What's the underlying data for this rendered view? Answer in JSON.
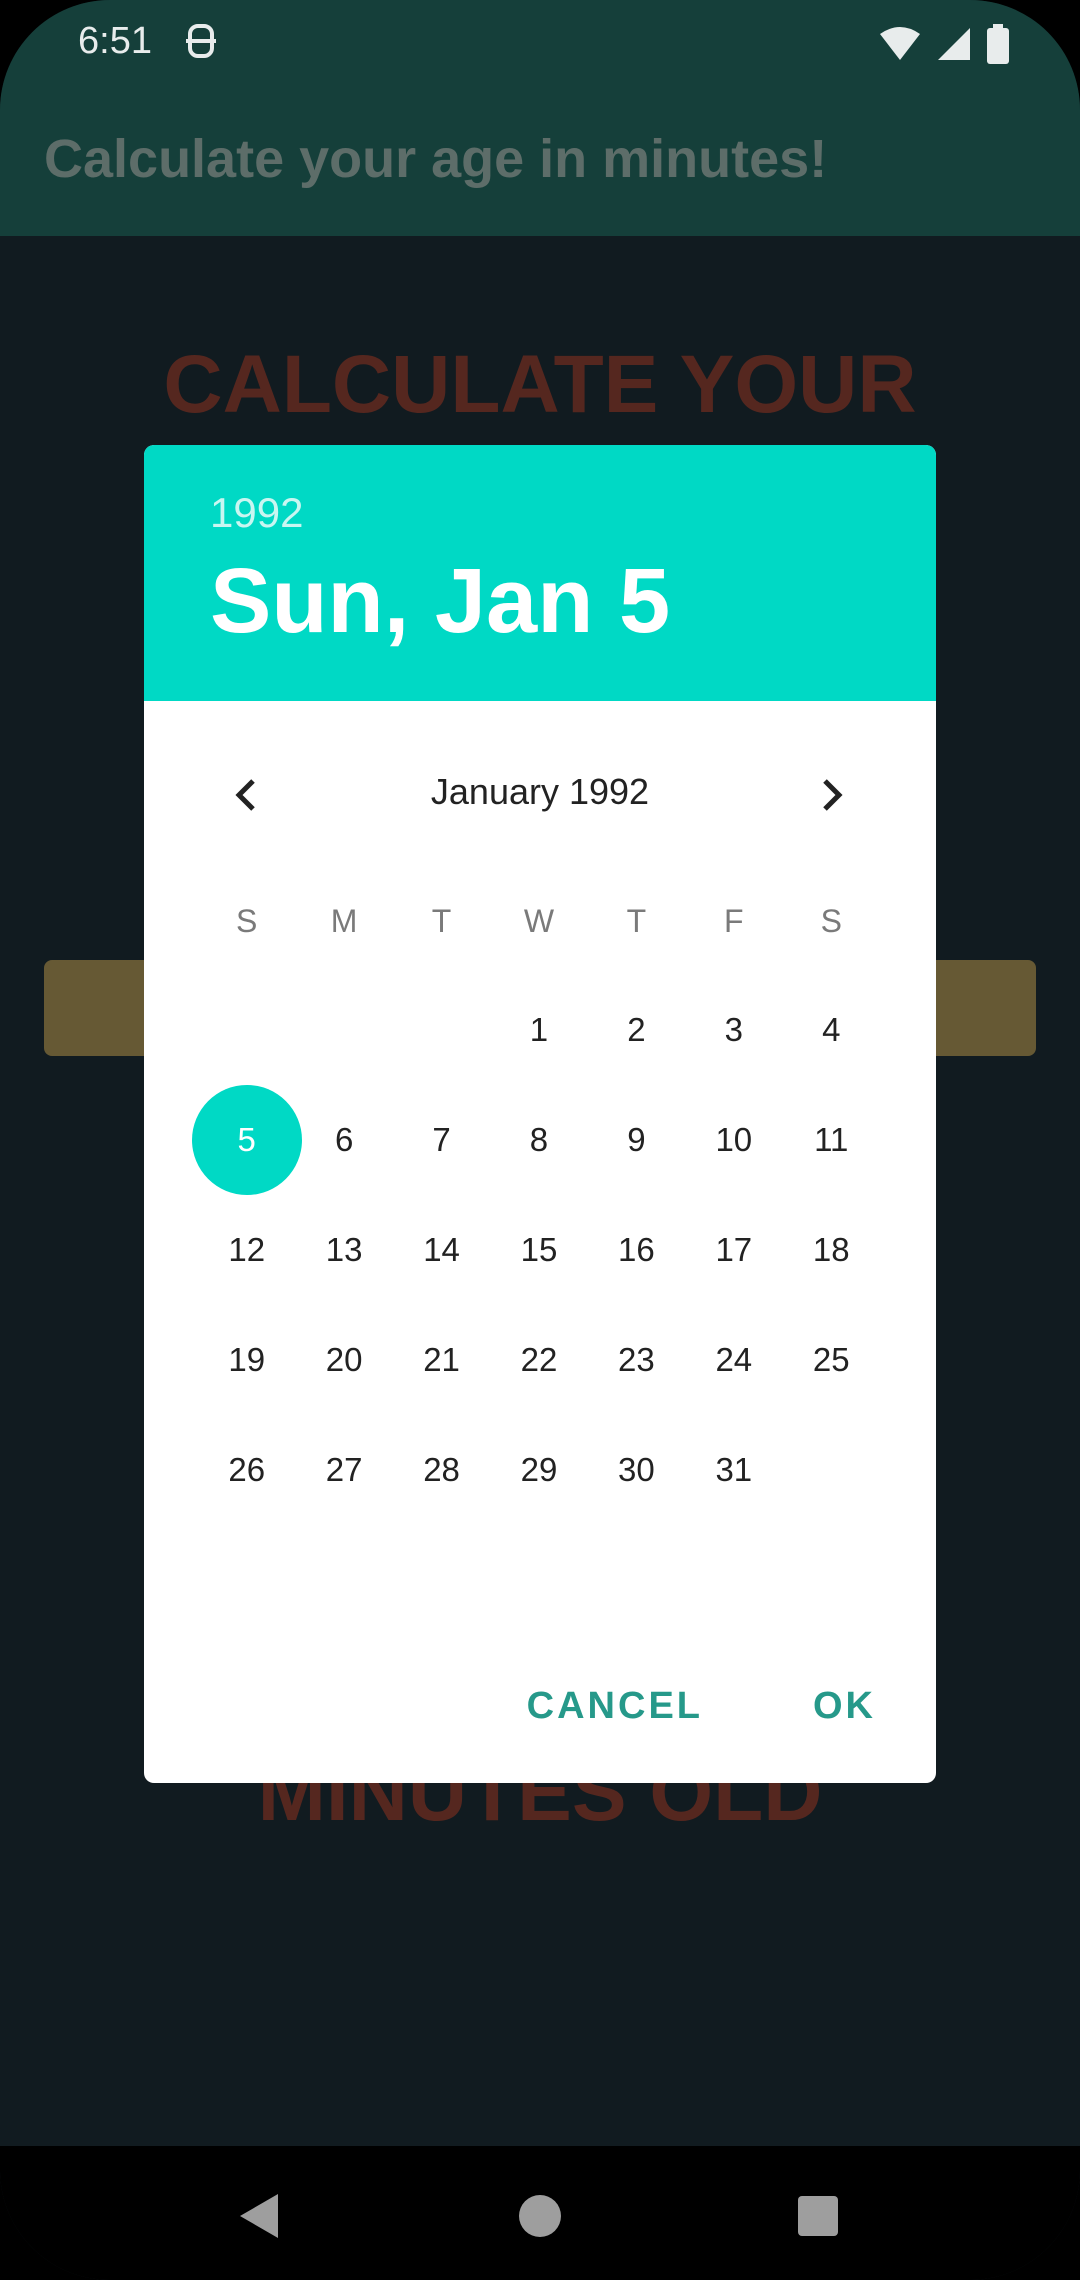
{
  "status": {
    "time": "6:51"
  },
  "app": {
    "title": "Calculate your age in minutes!",
    "bg_heading_top": "CALCULATE YOUR",
    "bg_heading_bottom": "MINUTES OLD"
  },
  "dialog": {
    "year": "1992",
    "selected_date": "Sun, Jan 5",
    "month_title": "January 1992",
    "weekdays": [
      "S",
      "M",
      "T",
      "W",
      "T",
      "F",
      "S"
    ],
    "days": [
      "",
      "",
      "",
      "1",
      "2",
      "3",
      "4",
      "5",
      "6",
      "7",
      "8",
      "9",
      "10",
      "11",
      "12",
      "13",
      "14",
      "15",
      "16",
      "17",
      "18",
      "19",
      "20",
      "21",
      "22",
      "23",
      "24",
      "25",
      "26",
      "27",
      "28",
      "29",
      "30",
      "31",
      ""
    ],
    "selected_day": "5",
    "cancel_label": "CANCEL",
    "ok_label": "OK"
  },
  "colors": {
    "accent": "#00d9c5",
    "action_text": "#26998a",
    "app_bar": "#153f3a"
  },
  "icons": {
    "prev": "chevron-left-icon",
    "next": "chevron-right-icon",
    "back": "back-triangle-icon",
    "home": "home-circle-icon",
    "recents": "recents-square-icon"
  }
}
